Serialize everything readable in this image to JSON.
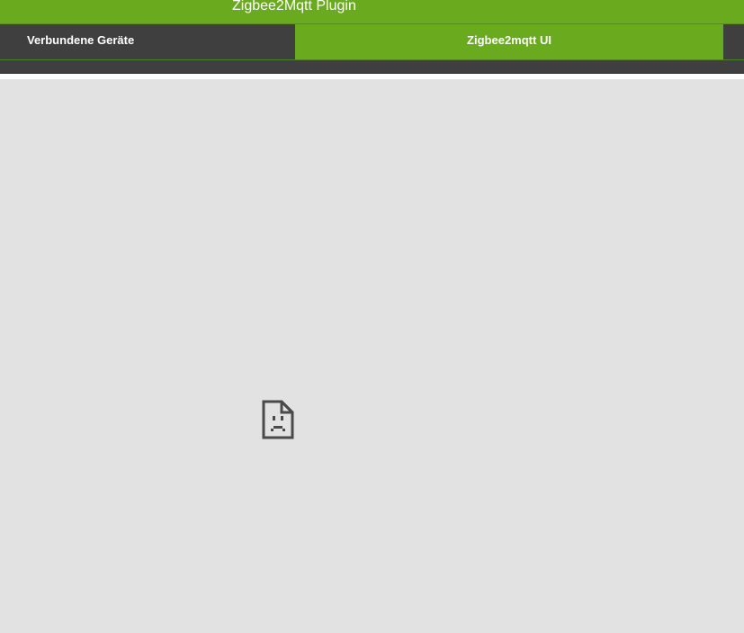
{
  "header": {
    "title": "Zigbee2Mqtt Plugin"
  },
  "tabs": [
    {
      "label": "Verbundene Geräte",
      "active": false
    },
    {
      "label": "Zigbee2mqtt UI",
      "active": true
    }
  ],
  "content": {
    "icon": "broken-document-icon"
  },
  "colors": {
    "accent": "#6aaa1f",
    "tab_bar": "#3f3f3f",
    "frame_background": "#e2e2e2",
    "icon": "#4a4a4a"
  }
}
